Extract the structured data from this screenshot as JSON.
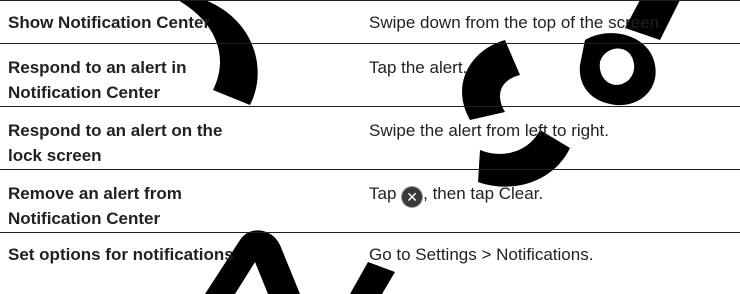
{
  "rows": [
    {
      "action": "Show Notification Center",
      "how": "Swipe down from the top of the screen."
    },
    {
      "action": "Respond to an alert in\nNotification Center",
      "how": "Tap the alert."
    },
    {
      "action": "Respond to an alert on the\nlock screen",
      "how": "Swipe the alert from left to right."
    },
    {
      "action": "Remove an alert from\nNotification Center",
      "how_before_icon": "Tap ",
      "icon": "clear-x-icon",
      "how_after_icon": ", then tap Clear."
    },
    {
      "action": "Set options for notifications",
      "how": "Go to Settings > Notifications."
    }
  ],
  "colors": {
    "text": "#231f20",
    "rule": "#231f20",
    "watermark": "#000000"
  }
}
